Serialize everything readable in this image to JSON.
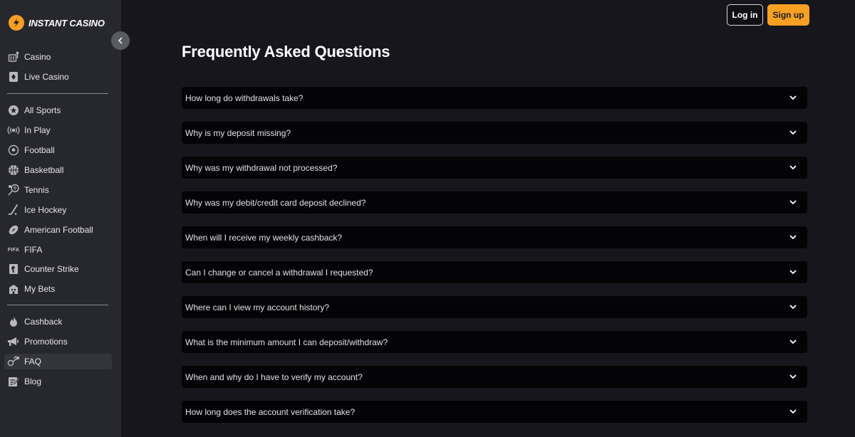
{
  "brand": {
    "name": "INSTANT CASINO",
    "accent": "#f7a024"
  },
  "header": {
    "login_label": "Log in",
    "signup_label": "Sign up"
  },
  "sidebar": {
    "group1": [
      {
        "label": "Casino",
        "icon": "slot-machine-icon"
      },
      {
        "label": "Live Casino",
        "icon": "card-icon"
      }
    ],
    "group2": [
      {
        "label": "All Sports",
        "icon": "star-ball-icon"
      },
      {
        "label": "In Play",
        "icon": "broadcast-icon"
      },
      {
        "label": "Football",
        "icon": "soccer-ball-icon"
      },
      {
        "label": "Basketball",
        "icon": "basketball-icon"
      },
      {
        "label": "Tennis",
        "icon": "tennis-icon"
      },
      {
        "label": "Ice Hockey",
        "icon": "hockey-stick-icon"
      },
      {
        "label": "American Football",
        "icon": "american-football-icon"
      },
      {
        "label": "FIFA",
        "icon": "fifa-icon",
        "icon_text": "FIFA"
      },
      {
        "label": "Counter Strike",
        "icon": "counter-strike-icon"
      },
      {
        "label": "My Bets",
        "icon": "my-bets-icon"
      }
    ],
    "group3": [
      {
        "label": "Cashback",
        "icon": "flame-icon"
      },
      {
        "label": "Promotions",
        "icon": "megaphone-icon"
      },
      {
        "label": "FAQ",
        "icon": "faq-icon",
        "active": true
      },
      {
        "label": "Blog",
        "icon": "blog-icon"
      }
    ]
  },
  "main": {
    "title": "Frequently Asked Questions",
    "faqs": [
      "How long do withdrawals take?",
      "Why is my deposit missing?",
      "Why was my withdrawal not processed?",
      "Why was my debit/credit card deposit declined?",
      "When will I receive my weekly cashback?",
      "Can I change or cancel a withdrawal I requested?",
      "Where can I view my account history?",
      "What is the minimum amount I can deposit/withdraw?",
      "When and why do I have to verify my account?",
      "How long does the account verification take?"
    ]
  }
}
